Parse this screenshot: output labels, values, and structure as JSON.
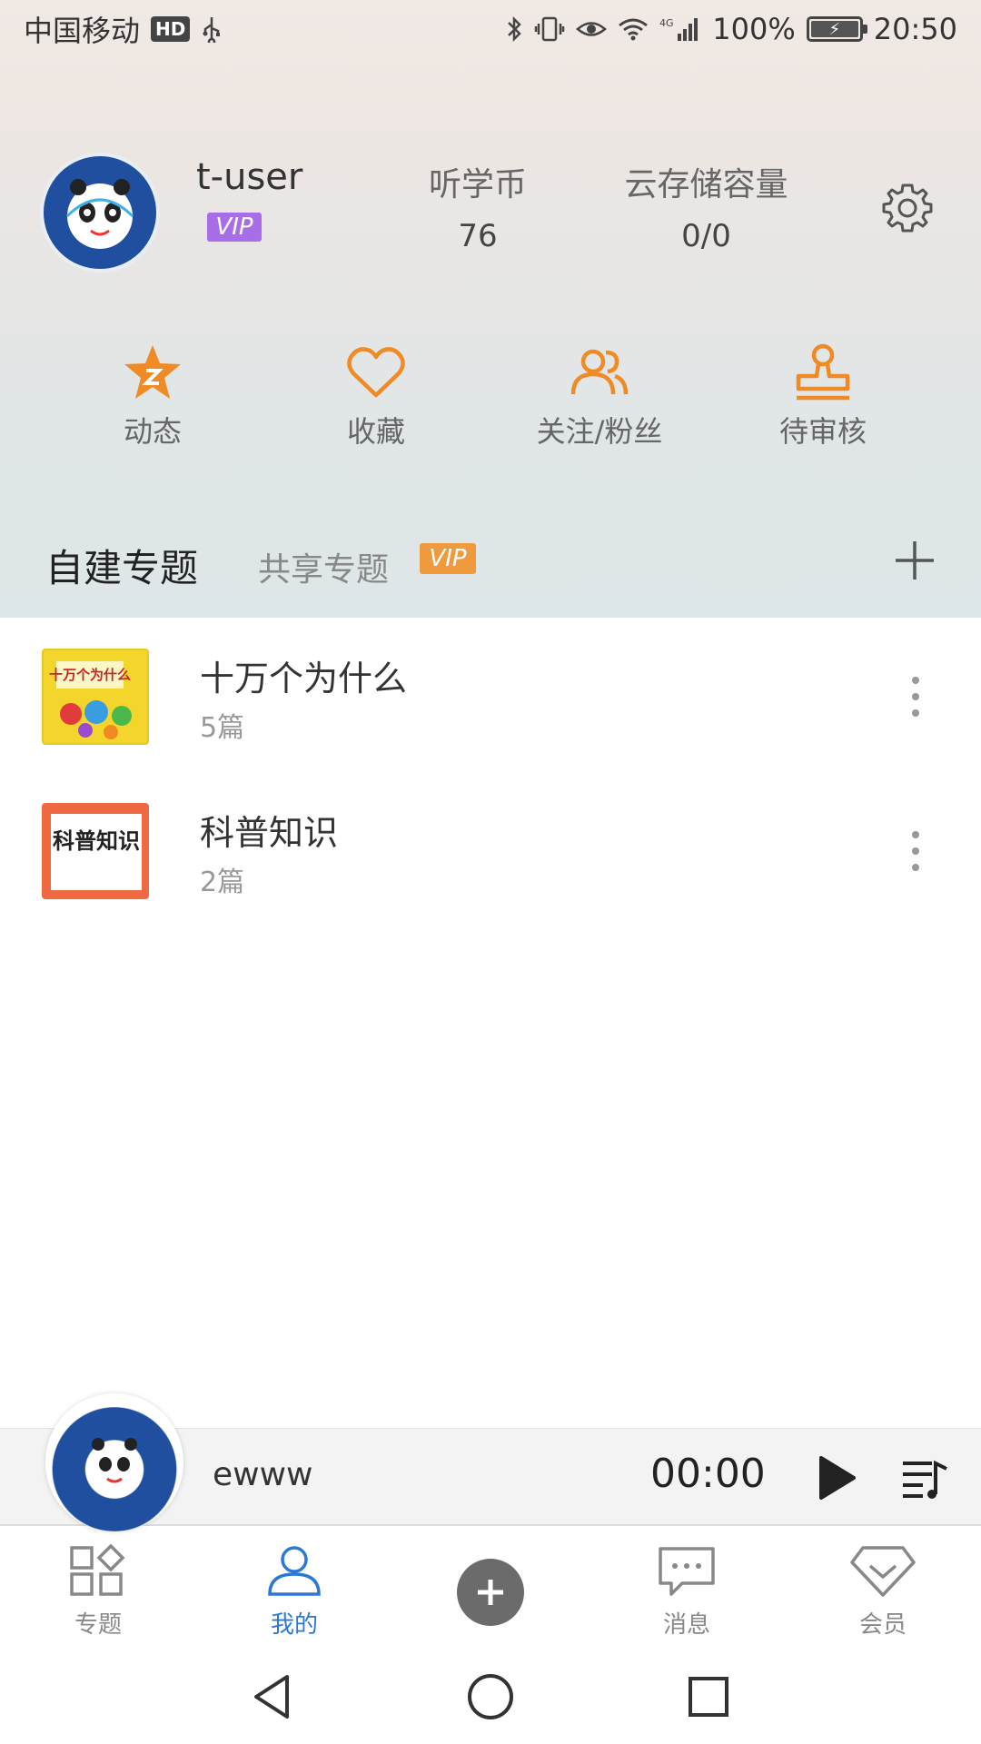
{
  "status_bar": {
    "carrier": "中国移动",
    "hd_badge": "HD",
    "signal_label": "4G",
    "battery": "100%",
    "time": "20:50"
  },
  "profile": {
    "username": "t-user",
    "vip_label": "VIP",
    "coins_label": "听学币",
    "coins_value": "76",
    "storage_label": "云存储容量",
    "storage_value": "0/0"
  },
  "actions": [
    {
      "label": "动态",
      "icon": "star-icon"
    },
    {
      "label": "收藏",
      "icon": "heart-icon"
    },
    {
      "label": "关注/粉丝",
      "icon": "people-icon"
    },
    {
      "label": "待审核",
      "icon": "stamp-icon"
    }
  ],
  "tabs": {
    "own": "自建专题",
    "shared": "共享专题",
    "shared_badge": "VIP"
  },
  "topics": [
    {
      "title": "十万个为什么",
      "count": "5篇",
      "cover_text": "十万个为什么"
    },
    {
      "title": "科普知识",
      "count": "2篇",
      "cover_text": "科普知识"
    }
  ],
  "player": {
    "track": "ewww",
    "time": "00:00"
  },
  "bottom_nav": [
    {
      "label": "专题",
      "icon": "grid-icon"
    },
    {
      "label": "我的",
      "icon": "user-icon"
    },
    {
      "label": "",
      "icon": "add-icon"
    },
    {
      "label": "消息",
      "icon": "chat-icon"
    },
    {
      "label": "会员",
      "icon": "diamond-icon"
    }
  ],
  "colors": {
    "accent_orange": "#f08a24",
    "active_blue": "#2d78d6",
    "vip_purple": "#a86ee8",
    "vip_orange": "#f09a3e"
  }
}
